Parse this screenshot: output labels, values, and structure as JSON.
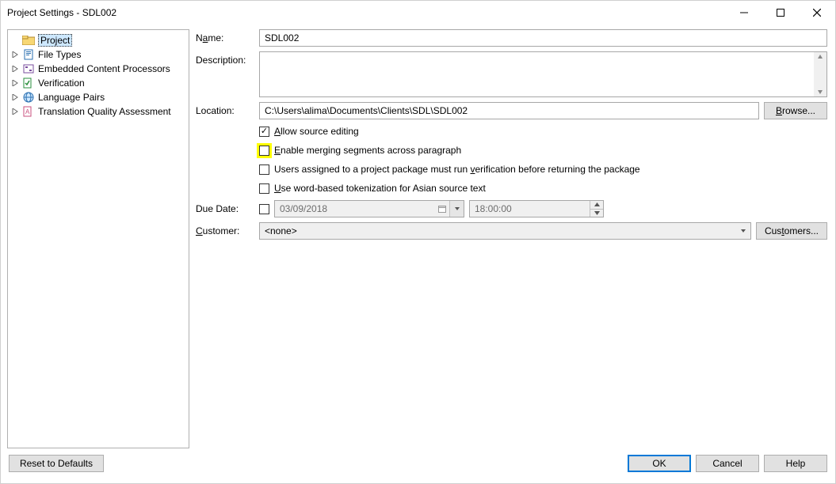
{
  "window": {
    "title": "Project Settings - SDL002"
  },
  "sidebar": {
    "items": [
      {
        "label": "Project",
        "icon": "folder",
        "selected": true
      },
      {
        "label": "File Types",
        "icon": "file"
      },
      {
        "label": "Embedded Content Processors",
        "icon": "embed"
      },
      {
        "label": "Verification",
        "icon": "verify"
      },
      {
        "label": "Language Pairs",
        "icon": "globe"
      },
      {
        "label": "Translation Quality Assessment",
        "icon": "quality"
      }
    ]
  },
  "form": {
    "name_label": "Name:",
    "name_value": "SDL002",
    "description_label": "Description:",
    "description_value": "",
    "location_label": "Location:",
    "location_value": "C:\\Users\\alima\\Documents\\Clients\\SDL\\SDL002",
    "browse_label": "Browse...",
    "checks": [
      {
        "label_pre": "",
        "u": "A",
        "label_post": "llow source editing",
        "checked": true,
        "highlight": false
      },
      {
        "label_pre": "",
        "u": "E",
        "label_post": "nable merging segments across paragraph",
        "checked": false,
        "highlight": true
      },
      {
        "label_pre": "Users assigned to a project package must run ",
        "u": "v",
        "label_post": "erification before returning the package",
        "checked": false,
        "highlight": false
      },
      {
        "label_pre": "",
        "u": "U",
        "label_post": "se word-based tokenization for Asian source text",
        "checked": false,
        "highlight": false
      }
    ],
    "due_date_label": "Due Date:",
    "due_date_enabled": false,
    "due_date_value": "03/09/2018",
    "due_time_value": "18:00:00",
    "customer_label_u": "C",
    "customer_label_post": "ustomer:",
    "customer_value": "<none>",
    "customers_button": "Customers..."
  },
  "footer": {
    "reset": "Reset to Defaults",
    "ok": "OK",
    "cancel": "Cancel",
    "help": "Help"
  }
}
